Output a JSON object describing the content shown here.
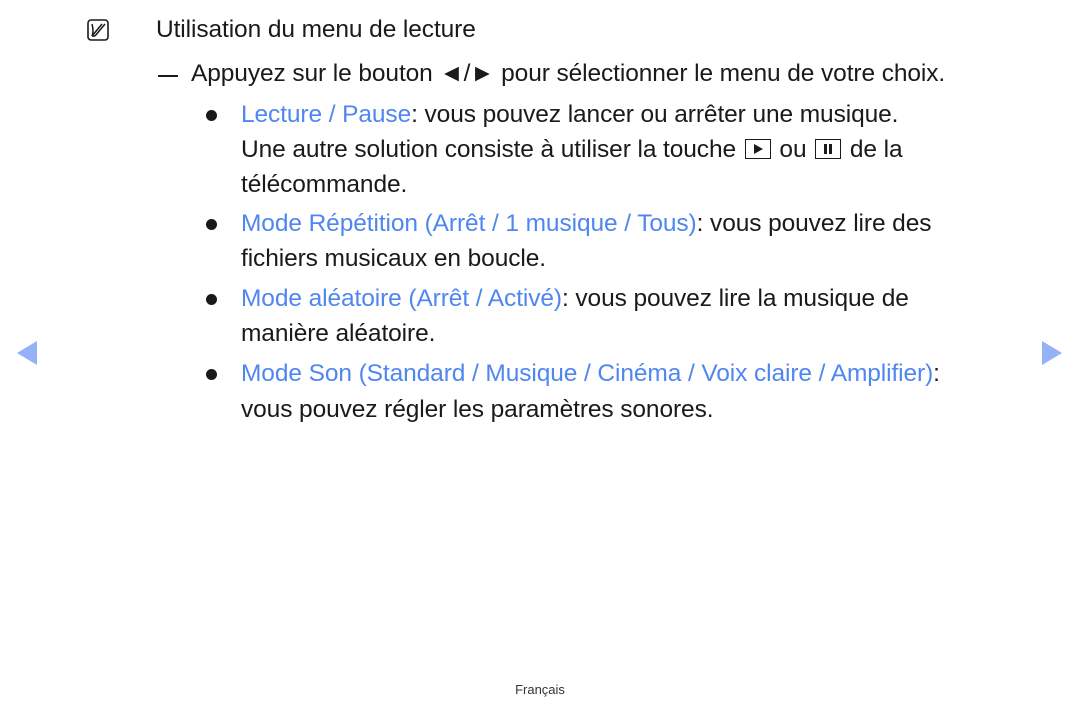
{
  "note": {
    "icon": "note-icon",
    "title": "Utilisation du menu de lecture"
  },
  "instruction": {
    "before": "Appuyez sur le bouton ",
    "arrows": "◄/►",
    "after": " pour sélectionner le menu de votre choix."
  },
  "items": [
    {
      "label": "Lecture / Pause",
      "text": ": vous pouvez lancer ou arrêter une musique.",
      "line2_before": "Une autre solution consiste à utiliser la touche ",
      "line2_mid": " ou ",
      "line2_after": " de la",
      "line3": "télécommande."
    },
    {
      "label": "Mode Répétition (Arrêt / 1 musique / Tous)",
      "text": ": vous pouvez lire des",
      "line2": "fichiers musicaux en boucle."
    },
    {
      "label": "Mode aléatoire (Arrêt / Activé)",
      "text": ": vous pouvez lire la musique de",
      "line2": "manière aléatoire."
    },
    {
      "label": "Mode Son (Standard / Musique / Cinéma / Voix claire / Amplifier)",
      "text": ":",
      "line2": "vous pouvez régler les paramètres sonores."
    }
  ],
  "nav": {
    "prev_icon": "triangle-left-icon",
    "next_icon": "triangle-right-icon",
    "color": "#93b2f7"
  },
  "accent_color": "#4f86f0",
  "footer": {
    "language": "Français"
  }
}
